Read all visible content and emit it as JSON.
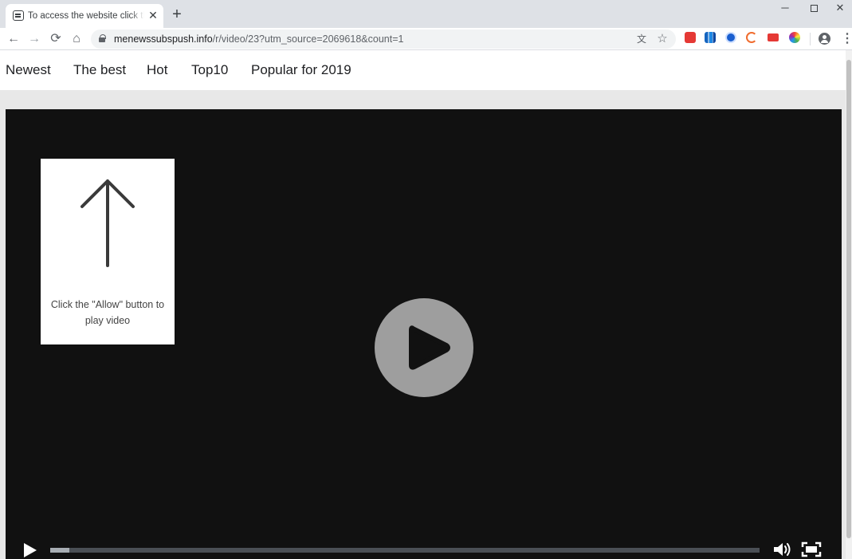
{
  "browser": {
    "tab": {
      "title": "To access the website click the \"Allow\" button",
      "close_glyph": "✕",
      "favicon": "video-favicon-icon"
    },
    "new_tab_glyph": "+",
    "window": {
      "minimize_glyph": "─",
      "close_glyph": "✕"
    },
    "nav": {
      "back_glyph": "←",
      "forward_glyph": "→",
      "reload_glyph": "⟳",
      "home_glyph": "⌂"
    },
    "address": {
      "host": "menewssubspush.info",
      "path": "/r/video/23?utm_source=2069618&count=1"
    },
    "omnibox_icons": {
      "translate_glyph": "文",
      "star_glyph": "☆"
    },
    "menu_glyph": "⋮"
  },
  "site_nav": {
    "items": [
      {
        "label": "Newest"
      },
      {
        "label": "The best"
      },
      {
        "label": "Hot"
      },
      {
        "label": "Top10"
      },
      {
        "label": "Popular for 2019"
      }
    ]
  },
  "player": {
    "prompt_text": "Click the \"Allow\" button to play video",
    "progress_fraction": 0.027
  },
  "colors": {
    "player_background": "#111111",
    "play_circle": "#9e9e9e",
    "page_band": "#e8e8e8"
  }
}
